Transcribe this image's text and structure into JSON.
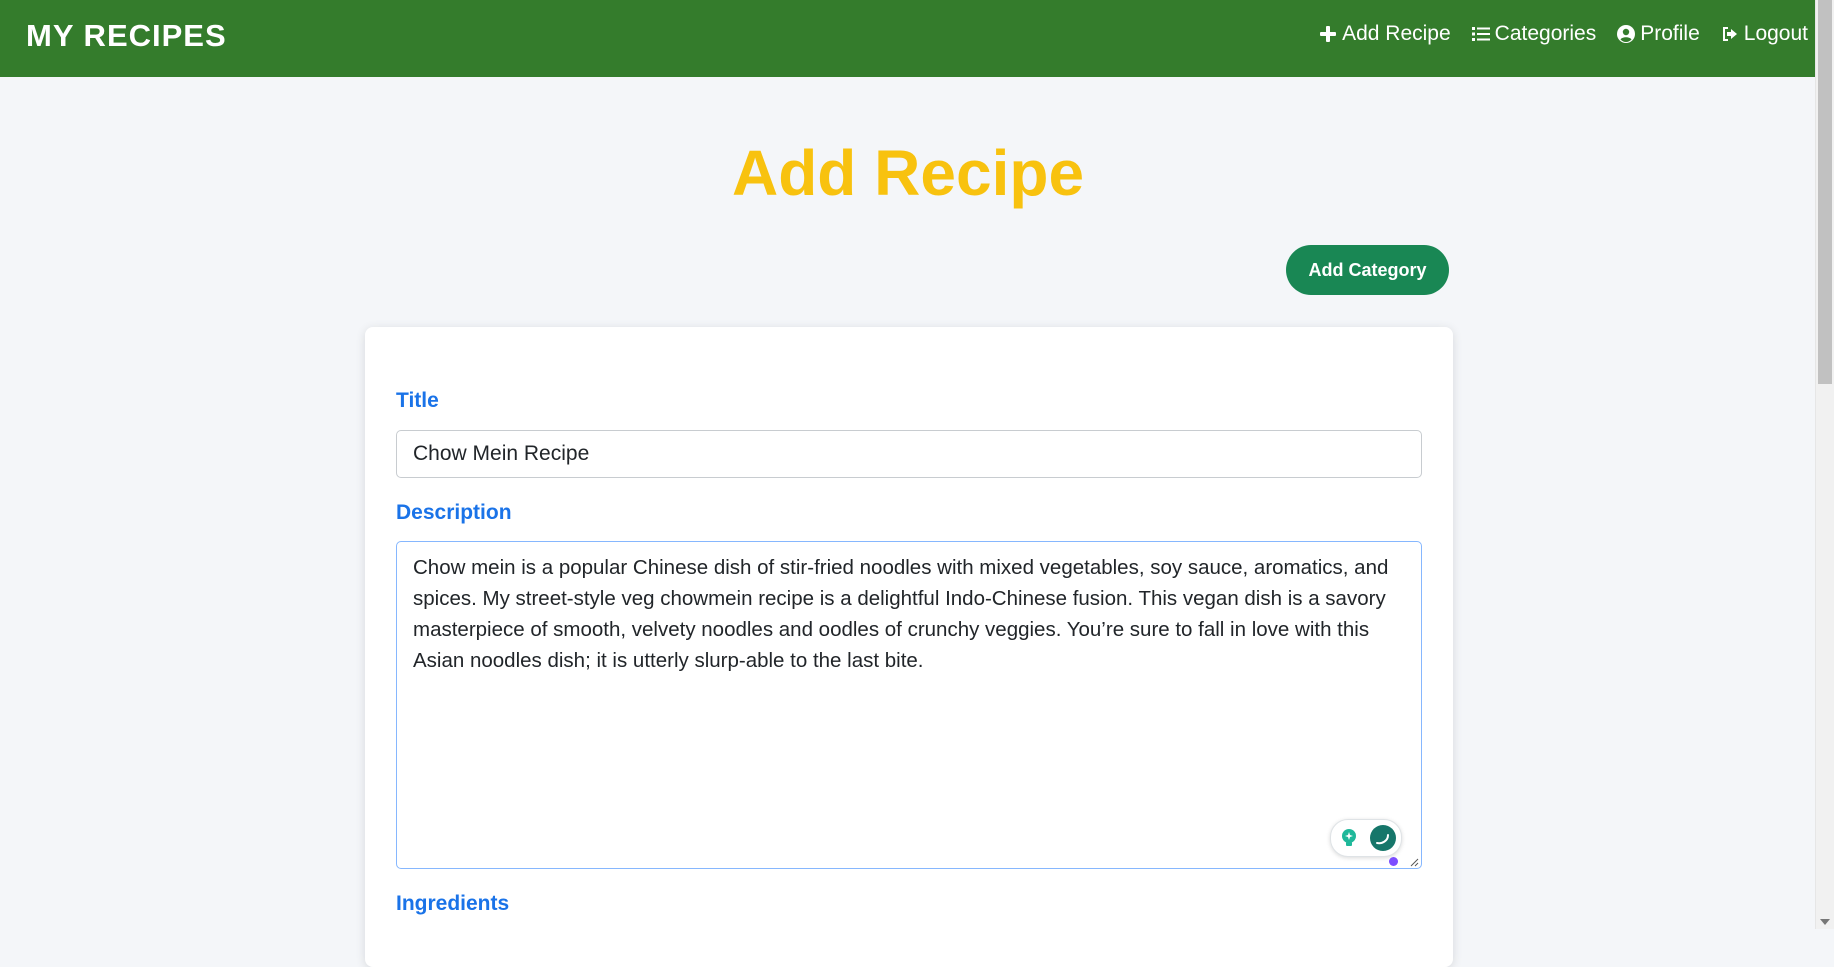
{
  "navbar": {
    "brand": "MY RECIPES",
    "links": [
      {
        "label": "Add Recipe",
        "icon": "plus-icon"
      },
      {
        "label": "Categories",
        "icon": "list-icon"
      },
      {
        "label": "Profile",
        "icon": "user-circle-icon"
      },
      {
        "label": "Logout",
        "icon": "logout-icon"
      }
    ]
  },
  "page": {
    "title": "Add Recipe",
    "add_category_label": "Add Category"
  },
  "form": {
    "title_label": "Title",
    "title_value": "Chow Mein Recipe",
    "description_label": "Description",
    "description_value": "Chow mein is a popular Chinese dish of stir-fried noodles with mixed vegetables, soy sauce, aromatics, and spices. My street-style veg chowmein recipe is a delightful Indo-Chinese fusion. This vegan dish is a savory masterpiece of smooth, velvety noodles and oodles of crunchy veggies. You’re sure to fall in love with this Asian noodles dish; it is utterly slurp-able to the last bite.",
    "ingredients_label": "Ingredients"
  },
  "colors": {
    "navbar": "#347c2c",
    "title": "#f8c20f",
    "button": "#198754",
    "label": "#1a73e8"
  }
}
